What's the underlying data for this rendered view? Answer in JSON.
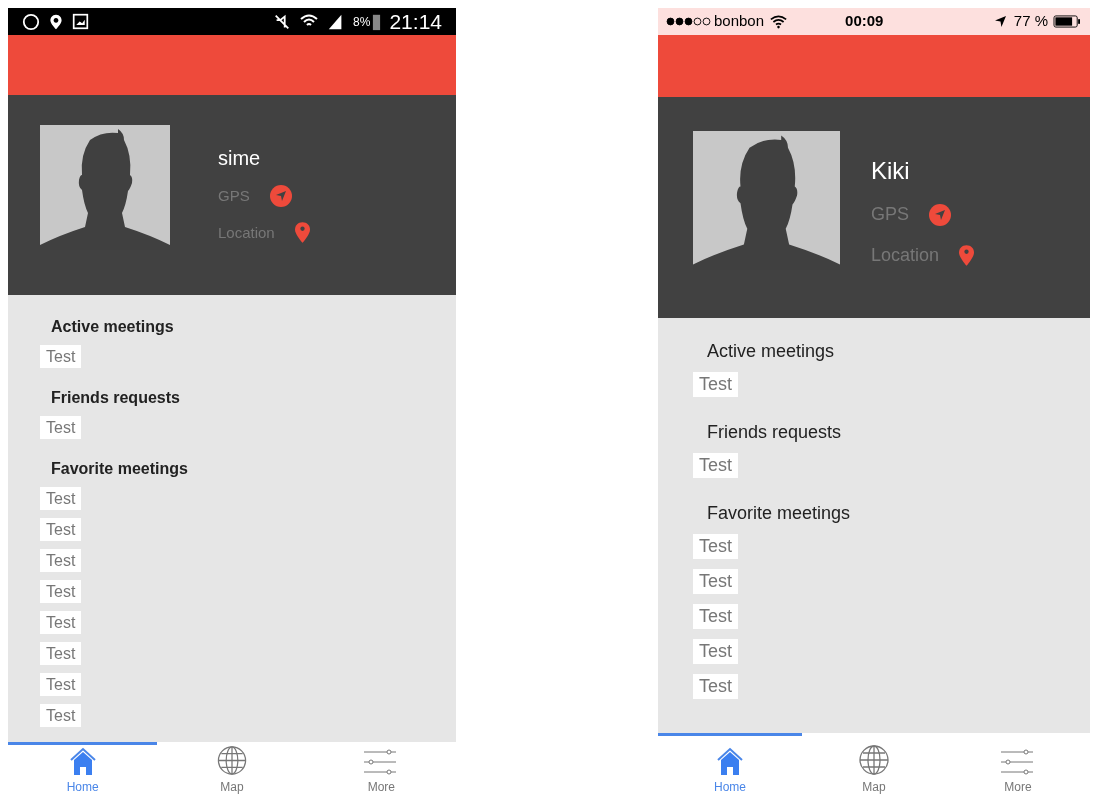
{
  "phones": [
    {
      "kind": "android",
      "status_bar": {
        "battery": "8%",
        "time": "21:14"
      },
      "profile": {
        "name": "sime",
        "gps_label": "GPS",
        "location_label": "Location"
      },
      "sections": [
        {
          "title": "Active meetings",
          "items": [
            "Test"
          ]
        },
        {
          "title": "Friends requests",
          "items": [
            "Test"
          ]
        },
        {
          "title": "Favorite meetings",
          "items": [
            "Test",
            "Test",
            "Test",
            "Test",
            "Test",
            "Test",
            "Test",
            "Test"
          ]
        }
      ],
      "tabs": [
        {
          "label": "Home",
          "selected": true
        },
        {
          "label": "Map",
          "selected": false
        },
        {
          "label": "More",
          "selected": false
        }
      ]
    },
    {
      "kind": "ios",
      "status_bar": {
        "carrier": "bonbon",
        "time": "00:09",
        "battery": "77 %"
      },
      "profile": {
        "name": "Kiki",
        "gps_label": "GPS",
        "location_label": "Location"
      },
      "sections": [
        {
          "title": "Active meetings",
          "items": [
            "Test"
          ]
        },
        {
          "title": "Friends requests",
          "items": [
            "Test"
          ]
        },
        {
          "title": "Favorite meetings",
          "items": [
            "Test",
            "Test",
            "Test",
            "Test",
            "Test"
          ]
        }
      ],
      "tabs": [
        {
          "label": "Home",
          "selected": true
        },
        {
          "label": "Map",
          "selected": false
        },
        {
          "label": "More",
          "selected": false
        }
      ]
    }
  ]
}
